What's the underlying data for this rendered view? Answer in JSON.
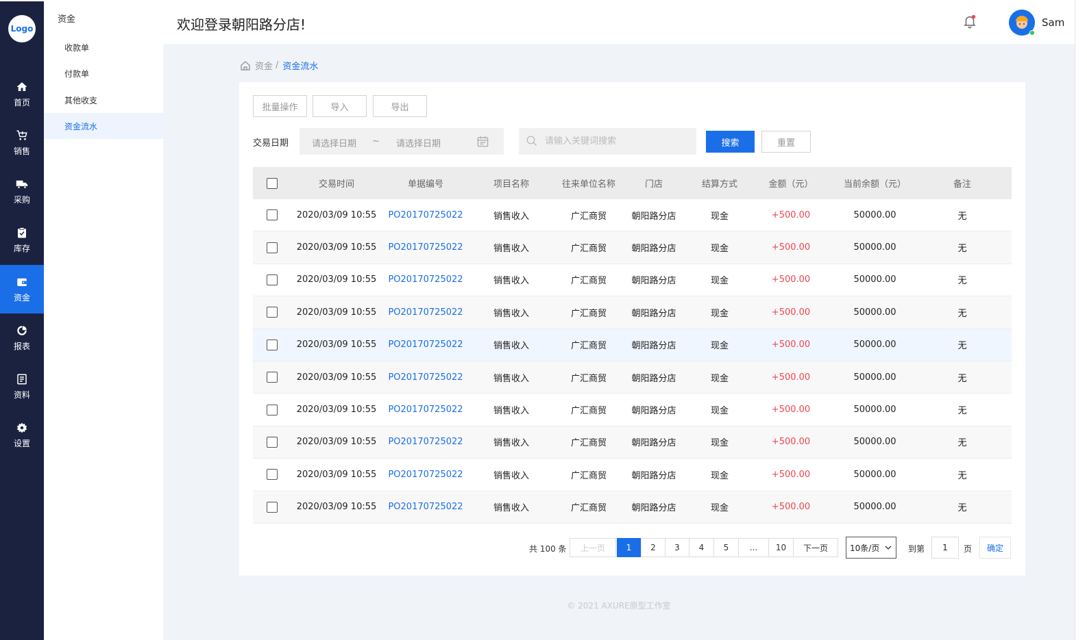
{
  "app": {
    "logo": "Logo",
    "welcome": "欢迎登录朝阳路分店!",
    "user": "Sam"
  },
  "nav": [
    {
      "label": "首页",
      "icon": "home-icon"
    },
    {
      "label": "销售",
      "icon": "cart-icon"
    },
    {
      "label": "采购",
      "icon": "truck-icon"
    },
    {
      "label": "库存",
      "icon": "clipboard-icon"
    },
    {
      "label": "资金",
      "icon": "wallet-icon",
      "active": true
    },
    {
      "label": "报表",
      "icon": "chart-icon"
    },
    {
      "label": "资料",
      "icon": "document-icon"
    },
    {
      "label": "设置",
      "icon": "gear-icon"
    }
  ],
  "subnav": {
    "title": "资金",
    "items": [
      "收款单",
      "付款单",
      "其他收支",
      "资金流水"
    ],
    "active": "资金流水"
  },
  "breadcrumb": {
    "parent": "资金",
    "separator": "/",
    "current": "资金流水"
  },
  "toolbar": {
    "batch": "批量操作",
    "import": "导入",
    "export": "导出"
  },
  "filters": {
    "date_label": "交易日期",
    "start_placeholder": "请选择日期",
    "tilde": "~",
    "end_placeholder": "请选择日期",
    "search_placeholder": "请输入关键词搜索",
    "search_button": "搜索",
    "reset_button": "重置"
  },
  "table": {
    "columns": [
      "交易时间",
      "单据编号",
      "项目名称",
      "往来单位名称",
      "门店",
      "结算方式",
      "金额（元）",
      "当前余额（元）",
      "备注"
    ],
    "rows": [
      [
        "2020/03/09 10:55",
        "PO20170725022",
        "销售收入",
        "广汇商贸",
        "朝阳路分店",
        "现金",
        "+500.00",
        "50000.00",
        "无"
      ],
      [
        "2020/03/09 10:55",
        "PO20170725022",
        "销售收入",
        "广汇商贸",
        "朝阳路分店",
        "现金",
        "+500.00",
        "50000.00",
        "无"
      ],
      [
        "2020/03/09 10:55",
        "PO20170725022",
        "销售收入",
        "广汇商贸",
        "朝阳路分店",
        "现金",
        "+500.00",
        "50000.00",
        "无"
      ],
      [
        "2020/03/09 10:55",
        "PO20170725022",
        "销售收入",
        "广汇商贸",
        "朝阳路分店",
        "现金",
        "+500.00",
        "50000.00",
        "无"
      ],
      [
        "2020/03/09 10:55",
        "PO20170725022",
        "销售收入",
        "广汇商贸",
        "朝阳路分店",
        "现金",
        "+500.00",
        "50000.00",
        "无"
      ],
      [
        "2020/03/09 10:55",
        "PO20170725022",
        "销售收入",
        "广汇商贸",
        "朝阳路分店",
        "现金",
        "+500.00",
        "50000.00",
        "无"
      ],
      [
        "2020/03/09 10:55",
        "PO20170725022",
        "销售收入",
        "广汇商贸",
        "朝阳路分店",
        "现金",
        "+500.00",
        "50000.00",
        "无"
      ],
      [
        "2020/03/09 10:55",
        "PO20170725022",
        "销售收入",
        "广汇商贸",
        "朝阳路分店",
        "现金",
        "+500.00",
        "50000.00",
        "无"
      ],
      [
        "2020/03/09 10:55",
        "PO20170725022",
        "销售收入",
        "广汇商贸",
        "朝阳路分店",
        "现金",
        "+500.00",
        "50000.00",
        "无"
      ],
      [
        "2020/03/09 10:55",
        "PO20170725022",
        "销售收入",
        "广汇商贸",
        "朝阳路分店",
        "现金",
        "+500.00",
        "50000.00",
        "无"
      ]
    ]
  },
  "pagination": {
    "total": "共 100 条",
    "prev": "上一页",
    "pages": [
      "1",
      "2",
      "3",
      "4",
      "5",
      "...",
      "10"
    ],
    "current": "1",
    "next": "下一页",
    "page_size": "10条/页",
    "goto_prefix": "到第",
    "goto_value": "1",
    "goto_suffix": "页",
    "confirm": "确定"
  },
  "footer": "© 2021   AXURE原型工作室",
  "colors": {
    "primary": "#1a6fe8",
    "nav_bg": "#1b2240",
    "amount": "#f0454f"
  }
}
